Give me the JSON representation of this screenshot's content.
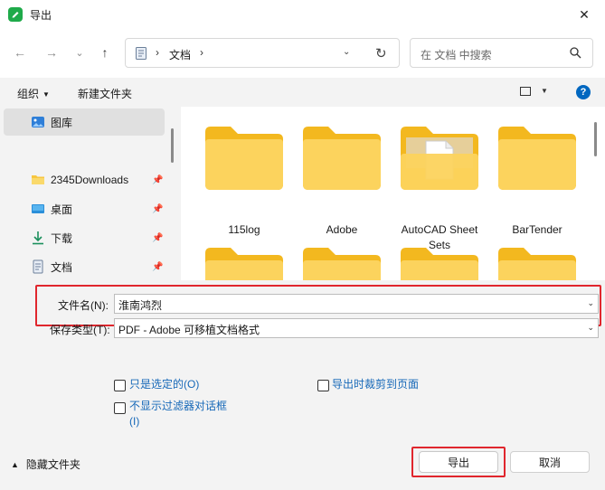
{
  "window": {
    "title": "导出",
    "close_glyph": "✕"
  },
  "nav": {
    "back_glyph": "←",
    "forward_glyph": "→",
    "recent_glyph": "⌄",
    "up_glyph": "↑",
    "breadcrumb_sep": "›",
    "breadcrumb": "文档",
    "dropdown_glyph": "⌄",
    "refresh_glyph": "↻",
    "search_placeholder": "在 文档 中搜索"
  },
  "toolbar": {
    "organize": "组织",
    "new_folder": "新建文件夹",
    "help": "?"
  },
  "sidebar": {
    "items": [
      {
        "label": "图库",
        "icon": "gallery-icon",
        "pinned": false
      },
      {
        "label": "2345Downloads",
        "icon": "folder-icon",
        "pinned": true
      },
      {
        "label": "桌面",
        "icon": "desktop-icon",
        "pinned": true
      },
      {
        "label": "下载",
        "icon": "download-icon",
        "pinned": true
      },
      {
        "label": "文档",
        "icon": "document-icon",
        "pinned": true
      }
    ]
  },
  "folders": [
    {
      "name": "115log",
      "type": "plain"
    },
    {
      "name": "Adobe",
      "type": "plain"
    },
    {
      "name": "AutoCAD Sheet Sets",
      "type": "with-document"
    },
    {
      "name": "BarTender",
      "type": "plain"
    },
    {
      "name": "",
      "type": "plain"
    },
    {
      "name": "",
      "type": "plain"
    },
    {
      "name": "",
      "type": "plain"
    },
    {
      "name": "",
      "type": "plain"
    }
  ],
  "form": {
    "filename_label": "文件名(N):",
    "filename_value": "淮南鸿烈",
    "filetype_label": "保存类型(T):",
    "filetype_value": "PDF - Adobe 可移植文档格式"
  },
  "options": {
    "selected_only": "只是选定的(O)",
    "crop_to_page": "导出时裁剪到页面",
    "no_filter_dialog": "不显示过滤器对话框",
    "no_filter_dialog_key": "(I)"
  },
  "footer": {
    "hide_folders": "隐藏文件夹",
    "export": "导出",
    "cancel": "取消"
  },
  "colors": {
    "accent": "#0067c0",
    "highlight_box": "#e0262d",
    "folder": "#f7c640",
    "link_text": "#1668b8"
  }
}
